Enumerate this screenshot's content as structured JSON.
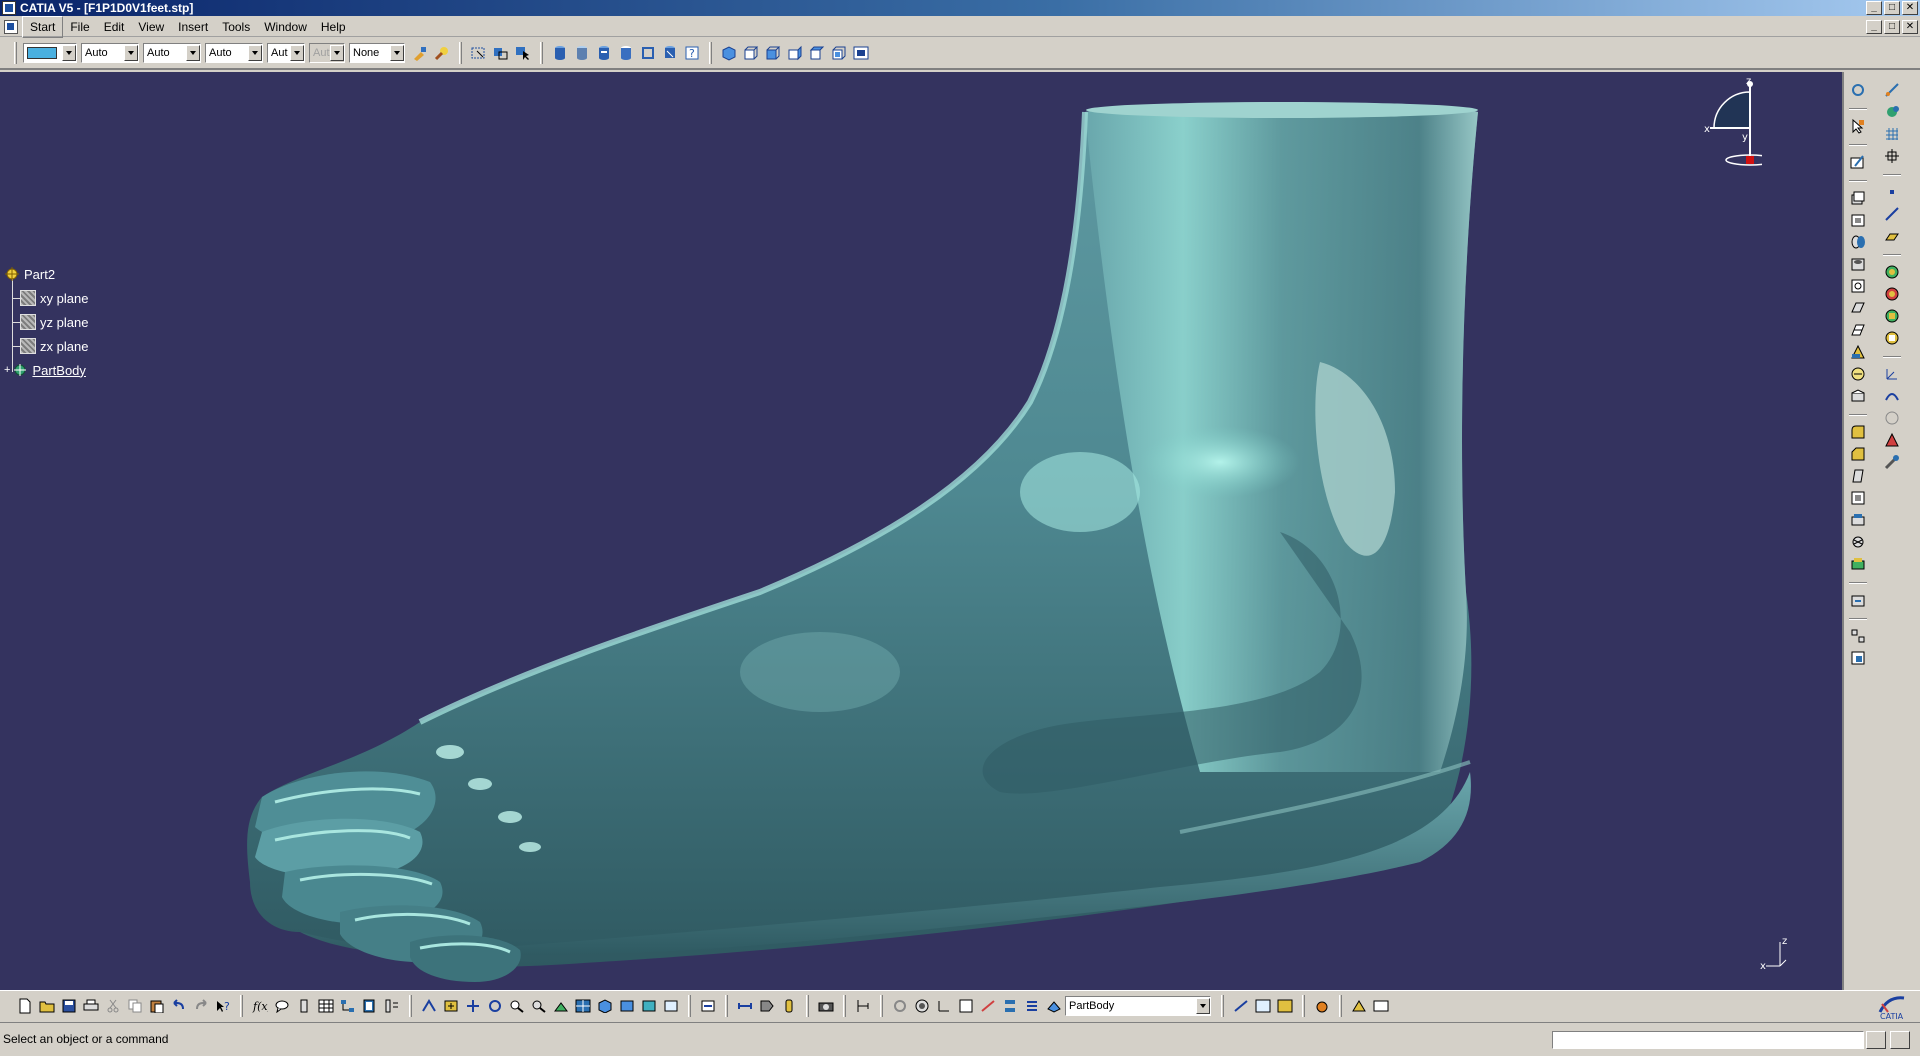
{
  "window": {
    "title": "CATIA V5 - [F1P1D0V1feet.stp]",
    "buttons": [
      "_",
      "□",
      "✕"
    ]
  },
  "menu": {
    "items": [
      "Start",
      "File",
      "Edit",
      "View",
      "Insert",
      "Tools",
      "Window",
      "Help"
    ],
    "mdi_buttons": [
      "_",
      "□",
      "✕"
    ]
  },
  "graphic_properties": {
    "color": "",
    "line_type": "Auto",
    "line_weight": "Auto",
    "transparency": "Auto",
    "point": "Aut",
    "layer_disabled": "Aut",
    "layer": "None"
  },
  "tree": {
    "root": "Part2",
    "children": [
      "xy plane",
      "yz plane",
      "zx plane"
    ],
    "body": "PartBody"
  },
  "compass": {
    "x": "x",
    "y": "y",
    "z": "z"
  },
  "axis": {
    "x": "x",
    "z": "z"
  },
  "bottom": {
    "current_body": "PartBody"
  },
  "status": {
    "message": "Select an object or a command",
    "command_input": ""
  },
  "colors": {
    "background": "#34335f",
    "surface": "#5f9a9e",
    "highlight": "#9fe6e0",
    "ui": "#d4d0c8"
  },
  "icons": {
    "top": [
      "painter-icon",
      "flashlight-icon",
      "select-icon",
      "select-trap-icon",
      "select-cursor-icon",
      "cylinder-icon",
      "cylinder2-icon",
      "cylinder3-icon",
      "cylinder4-icon",
      "cylinder5-icon",
      "cylinder6-icon",
      "help-icon",
      "view-iso-icon",
      "view-front-icon",
      "view-back-icon",
      "view-left-icon",
      "view-right-icon",
      "view-top-icon",
      "view-bottom-icon"
    ]
  }
}
